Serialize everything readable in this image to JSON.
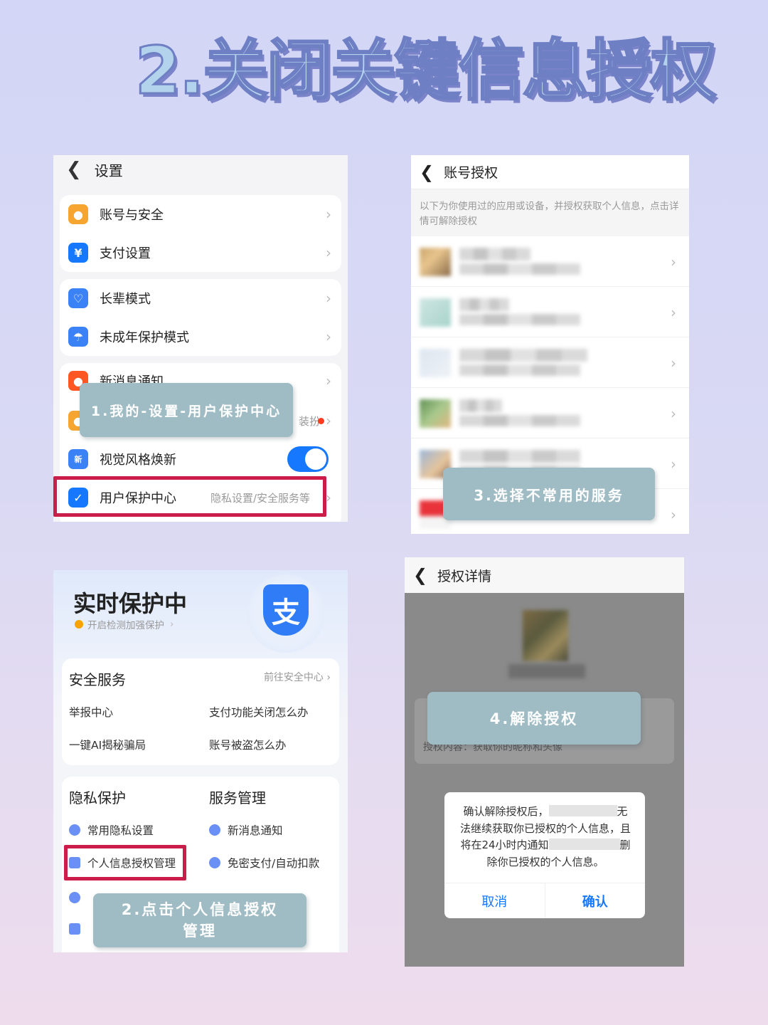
{
  "title": "2.关闭关键信息授权",
  "settings": {
    "header": "设置",
    "items": [
      {
        "label": "账号与安全",
        "icon": "user-icon",
        "color": "#f5a623"
      },
      {
        "label": "支付设置",
        "icon": "yuan-icon",
        "color": "#1677ff"
      },
      {
        "label": "长辈模式",
        "icon": "heart-icon",
        "color": "#1677ff"
      },
      {
        "label": "未成年保护模式",
        "icon": "umbrella-icon",
        "color": "#1677ff"
      },
      {
        "label": "新消息通知",
        "icon": "bell-icon",
        "color": "#ff5722"
      },
      {
        "label": "视觉风格焕新",
        "icon": "style-icon",
        "color": "#1677ff"
      },
      {
        "label": "用户保护中心",
        "icon": "shield-icon",
        "color": "#1677ff"
      }
    ],
    "partial_sub": "装扮",
    "protect_sub": "隐私设置/安全服务等",
    "callout": "1.我的-设置-用户保护中心"
  },
  "account_auth": {
    "header": "账号授权",
    "description": "以下为你使用过的应用或设备，并授权获取个人信息，点击详情可解除授权",
    "callout": "3.选择不常用的服务"
  },
  "protection": {
    "title": "实时保护中",
    "status": "开启检测加强保护",
    "shield_char": "支",
    "security_title": "安全服务",
    "goto": "前往安全中心",
    "security_items": [
      "举报中心",
      "支付功能关闭怎么办",
      "一键AI揭秘骗局",
      "账号被盗怎么办"
    ],
    "privacy_title": "隐私保护",
    "service_title": "服务管理",
    "privacy_items": [
      "常用隐私设置",
      "个人信息授权管理"
    ],
    "service_items": [
      "新消息通知",
      "免密支付/自动扣款"
    ],
    "callout": "2.点击个人信息授权管理"
  },
  "auth_detail": {
    "header": "授权详情",
    "content_label": "授权内容：",
    "content_value": "获取你的昵称和头像",
    "callout": "4.解除授权",
    "dialog_text_1": "确认解除授权后，",
    "dialog_text_1b": "无",
    "dialog_text_2": "法继续获取你已授权的个人信息，且",
    "dialog_text_3": "将在24小时内通知",
    "dialog_text_3b": "删",
    "dialog_text_4": "除你已授权的个人信息。",
    "cancel": "取消",
    "confirm": "确认"
  }
}
